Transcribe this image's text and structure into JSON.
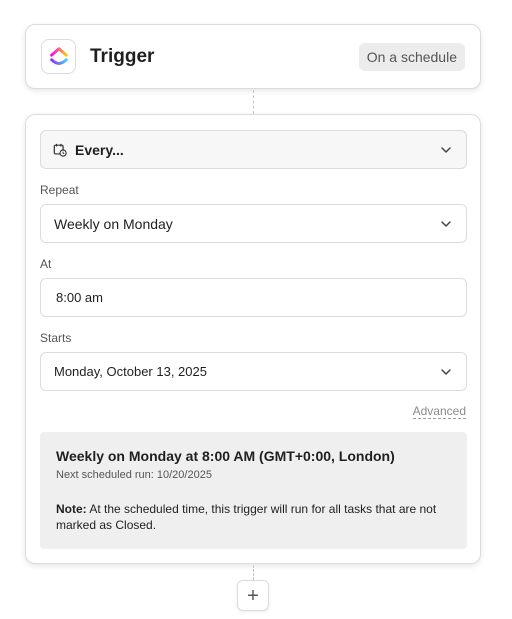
{
  "trigger": {
    "title": "Trigger",
    "badge": "On a schedule"
  },
  "schedule": {
    "mode_label": "Every...",
    "repeat": {
      "label": "Repeat",
      "value": "Weekly on Monday"
    },
    "at": {
      "label": "At",
      "value": "8:00 am"
    },
    "starts": {
      "label": "Starts",
      "value": "Monday, October 13, 2025"
    },
    "advanced_label": "Advanced"
  },
  "summary": {
    "title": "Weekly on Monday at 8:00 AM (GMT+0:00, London)",
    "next_run": "Next scheduled run: 10/20/2025",
    "note_label": "Note:",
    "note_text": " At the scheduled time, this trigger will run for all tasks that are not marked as Closed."
  },
  "add_button": {
    "label": "+"
  },
  "icons": {
    "logo": "clickup-logo",
    "calendar": "calendar-clock-icon",
    "chevron": "chevron-down-icon"
  }
}
